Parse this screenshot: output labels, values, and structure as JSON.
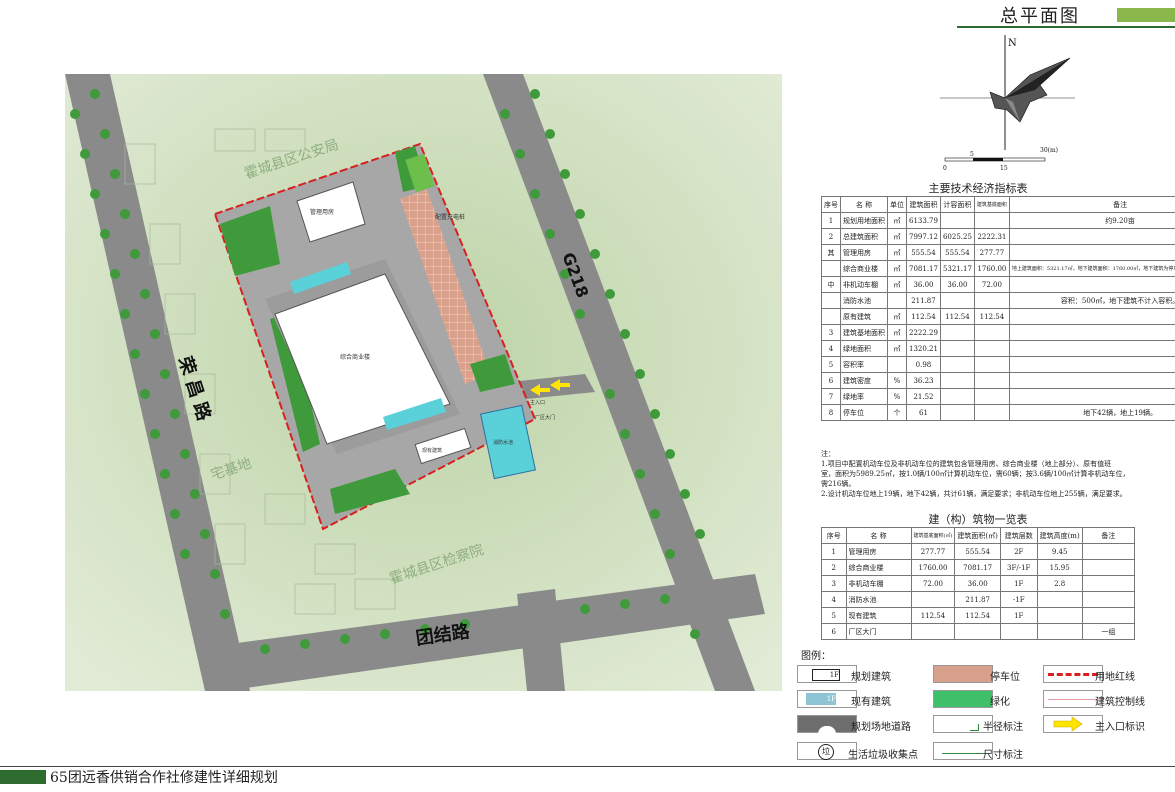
{
  "header": {
    "title": "总平面图"
  },
  "footer": {
    "project_title": "65团远香供销合作社修建性详细规划"
  },
  "compass": {
    "north": "N",
    "scale_labels": [
      "0",
      "5",
      "15",
      "30(m)"
    ]
  },
  "map_labels": {
    "police": "霍城县区公安局",
    "procuratorate": "霍城县区检察院",
    "homestead": "宅基地",
    "road_rongchang": "荣昌路",
    "road_tuanjie": "团结路",
    "road_g218": "G218",
    "charging": "配置充电桩",
    "mgmt_building": "管理用房",
    "main_building": "综合商业楼",
    "existing_building": "现有建筑",
    "entrance": "主入口",
    "gate": "厂区大门",
    "pool": "消防水池"
  },
  "indicator_table": {
    "title": "主要技术经济指标表",
    "headers": [
      "序号",
      "名 称",
      "单位",
      "建筑面积",
      "计容面积",
      "建筑基底面积",
      "备注"
    ],
    "rows": [
      [
        "1",
        "规划用地面积",
        "㎡",
        "6133.79",
        "",
        "",
        "约9.20亩"
      ],
      [
        "2",
        "总建筑面积",
        "㎡",
        "7997.12",
        "6025.25",
        "2222.31",
        ""
      ],
      [
        "",
        "管理用房",
        "㎡",
        "555.54",
        "555.54",
        "277.77",
        ""
      ],
      [
        "",
        "综合商业楼",
        "㎡",
        "7081.17",
        "5321.17",
        "1760.00",
        "地上建筑面积：5321.17㎡，地下建筑面积：1760.00㎡，地下建筑为停车库，不单独配置车位。"
      ],
      [
        "",
        "非机动车棚",
        "㎡",
        "36.00",
        "36.00",
        "72.00",
        ""
      ],
      [
        "",
        "消防水池",
        "",
        "211.87",
        "",
        "",
        "容积：500㎡，地下建筑不计入容积。"
      ],
      [
        "",
        "原有建筑",
        "㎡",
        "112.54",
        "112.54",
        "112.54",
        ""
      ],
      [
        "3",
        "建筑基地面积",
        "㎡",
        "2222.29",
        "",
        "",
        ""
      ],
      [
        "4",
        "绿地面积",
        "㎡",
        "1320.21",
        "",
        "",
        ""
      ],
      [
        "5",
        "容积率",
        "",
        "0.98",
        "",
        "",
        ""
      ],
      [
        "6",
        "建筑密度",
        "%",
        "36.23",
        "",
        "",
        ""
      ],
      [
        "7",
        "绿地率",
        "%",
        "21.52",
        "",
        "",
        ""
      ],
      [
        "8",
        "停车位",
        "个",
        "61",
        "",
        "",
        "地下42辆，地上19辆。"
      ]
    ],
    "group_label": [
      "其",
      "中"
    ]
  },
  "notes": {
    "heading": "注：",
    "lines": [
      "1.项目中配置机动车位及非机动车位的建筑包含管理用房、综合商业楼（地上部分）、原有值班",
      "室，面积为5989.25㎡，按1.0辆/100㎡计算机动车位，需60辆；按3.6辆/100㎡计算非机动车位，",
      "需216辆。",
      "2.设计机动车位地上19辆，地下42辆，共计61辆，满足要求；非机动车位地上255辆，满足要求。"
    ]
  },
  "building_table": {
    "title": "建（构）筑物一览表",
    "headers": [
      "序号",
      "名 称",
      "建筑基底面积(㎡)",
      "建筑面积(㎡)",
      "建筑层数",
      "建筑高度(m)",
      "备注"
    ],
    "rows": [
      [
        "1",
        "管理用房",
        "277.77",
        "555.54",
        "2F",
        "9.45",
        ""
      ],
      [
        "2",
        "综合商业楼",
        "1760.00",
        "7081.17",
        "3F/-1F",
        "15.95",
        ""
      ],
      [
        "3",
        "非机动车棚",
        "72.00",
        "36.00",
        "1F",
        "2.8",
        ""
      ],
      [
        "4",
        "消防水池",
        "",
        "211.87",
        "-1F",
        "",
        ""
      ],
      [
        "5",
        "现有建筑",
        "112.54",
        "112.54",
        "1F",
        "",
        ""
      ],
      [
        "6",
        "厂区大门",
        "",
        "",
        "",
        "",
        "一组"
      ]
    ]
  },
  "legend": {
    "title": "图例：",
    "items": [
      {
        "label": "规划建筑",
        "symbol_text": "1F"
      },
      {
        "label": "停车位"
      },
      {
        "label": "用地红线"
      },
      {
        "label": "现有建筑",
        "symbol_text": "1F"
      },
      {
        "label": "绿化"
      },
      {
        "label": "建筑控制线"
      },
      {
        "label": "规划场地道路"
      },
      {
        "label": "半径标注"
      },
      {
        "label": "主入口标识"
      },
      {
        "label": "生活垃圾收集点",
        "symbol_text": "垃"
      },
      {
        "label": "尺寸标注"
      }
    ]
  },
  "colors": {
    "green_dark": "#2e6b2e",
    "green_light": "#8ab84a",
    "background_green": "#dbe6cf",
    "road": "#8a8a8a",
    "redline": "#d82020",
    "parking": "#d9a08c",
    "greenery": "#3fbf6a",
    "cyan": "#5ad0d8",
    "arrow": "#ffe500"
  }
}
